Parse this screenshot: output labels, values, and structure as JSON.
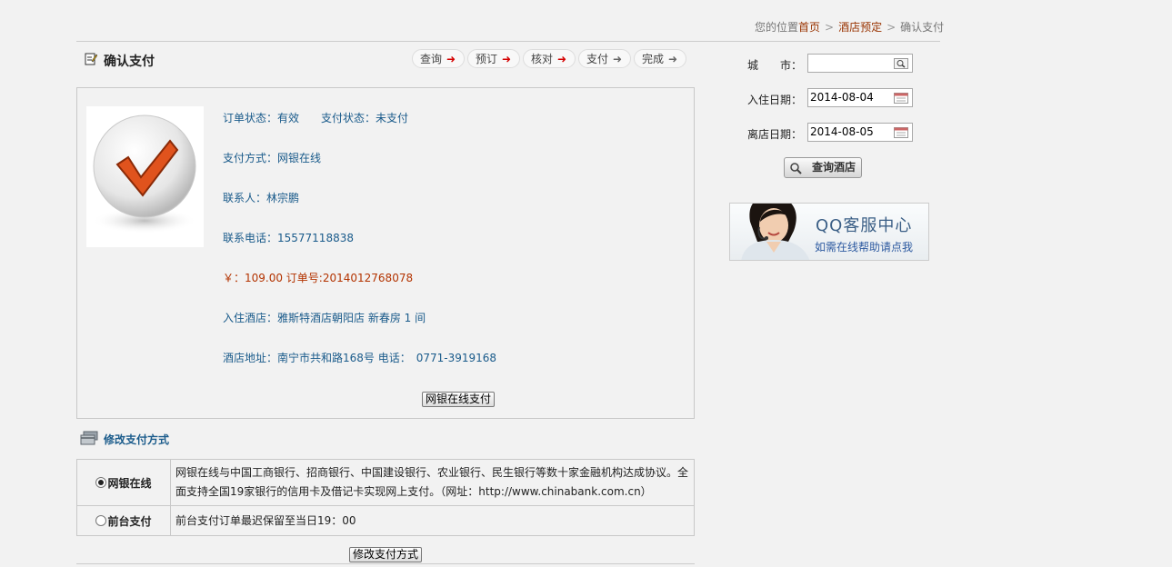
{
  "breadcrumb": {
    "prefix": "您的位置",
    "home": "首页",
    "section": "酒店预定",
    "current": "确认支付"
  },
  "page_title": "确认支付",
  "steps": [
    {
      "label": "查询",
      "arrow": "red"
    },
    {
      "label": "预订",
      "arrow": "red"
    },
    {
      "label": "核对",
      "arrow": "red"
    },
    {
      "label": "支付",
      "arrow": "grey"
    },
    {
      "label": "完成",
      "arrow": "grey"
    }
  ],
  "order": {
    "status_line": "订单状态：有效　　支付状态：未支付",
    "pay_method": "支付方式：网银在线",
    "contact": "联系人：林宗鹏",
    "phone": "联系电话：15577118838",
    "price_line": "￥：109.00 订单号:2014012768078",
    "hotel_line": "入住酒店：雅斯特酒店朝阳店 新春房  1 间",
    "address_line": "酒店地址：南宁市共和路168号 电话：　0771-3919168",
    "pay_button": "网银在线支付"
  },
  "payment_methods": {
    "title": "修改支付方式",
    "options": [
      {
        "label": "网银在线",
        "selected": true,
        "description": "网银在线与中国工商银行、招商银行、中国建设银行、农业银行、民生银行等数十家金融机构达成协议。全面支持全国19家银行的信用卡及借记卡实现网上支付。（网址：http://www.chinabank.com.cn）"
      },
      {
        "label": "前台支付",
        "selected": false,
        "description": "前台支付订单最迟保留至当日19：00"
      }
    ],
    "modify_button": "修改支付方式"
  },
  "search": {
    "city_label": "城　　市：",
    "city_value": "",
    "checkin_label": "入住日期：",
    "checkin_value": "2014-08-04",
    "checkout_label": "离店日期：",
    "checkout_value": "2014-08-05",
    "button": "查询酒店"
  },
  "qq": {
    "title": "QQ客服中心",
    "subtitle": "如需在线帮助请点我"
  },
  "colors": {
    "link_blue": "#1a5b8b",
    "accent_red": "#d40000",
    "price_red": "#b33300",
    "check_orange": "#e0531d"
  }
}
